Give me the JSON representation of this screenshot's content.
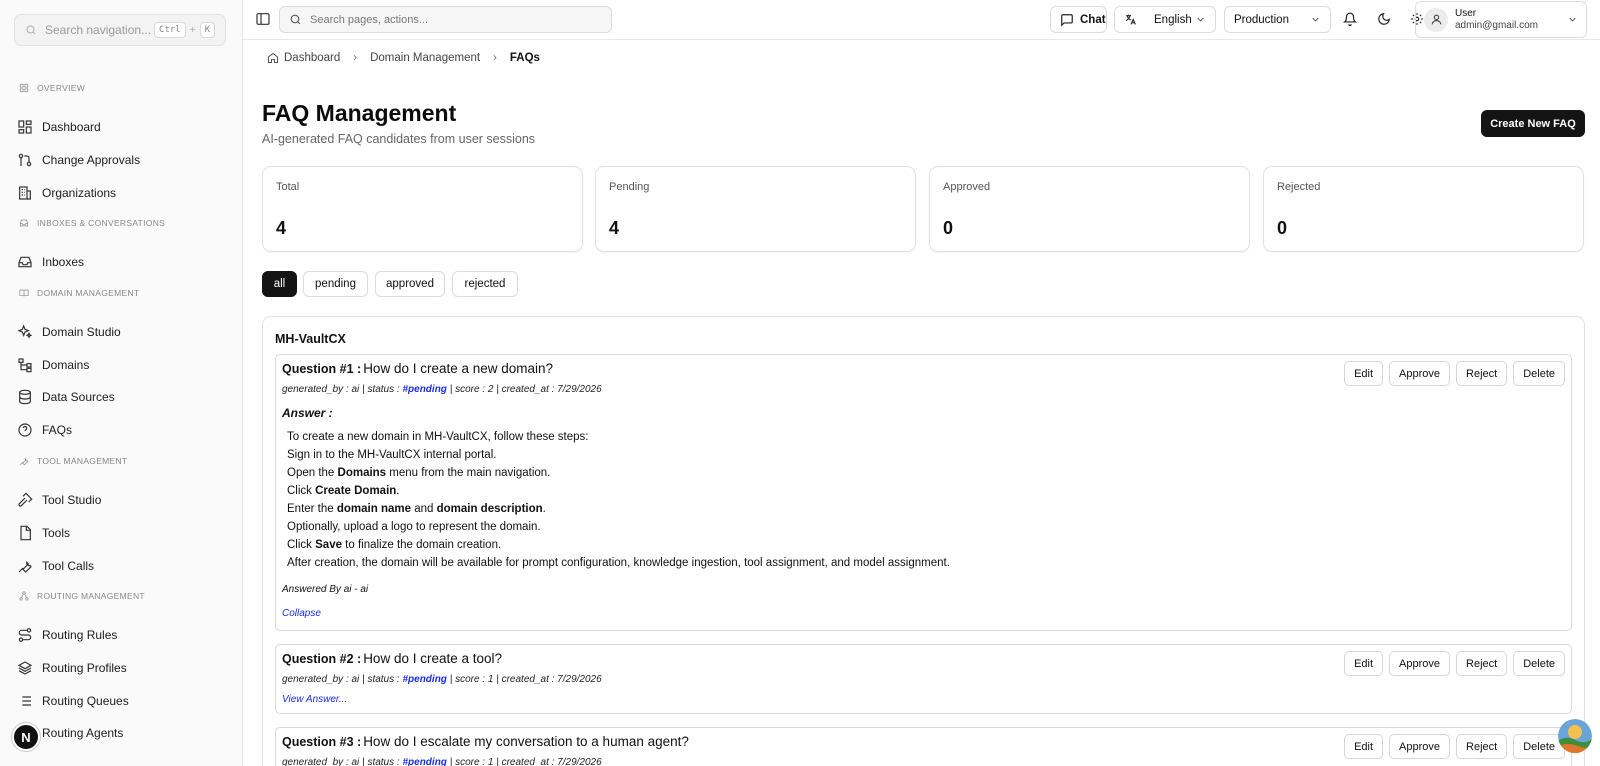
{
  "sidebar": {
    "search_placeholder": "Search navigation...",
    "kbd_1": "Ctrl",
    "kbd_sep": "+",
    "kbd_2": "K",
    "sections": {
      "overview": "OVERVIEW",
      "inboxes": "INBOXES & CONVERSATIONS",
      "domain": "DOMAIN MANAGEMENT",
      "tool": "TOOL MANAGEMENT",
      "routing": "ROUTING MANAGEMENT"
    },
    "items": {
      "dashboard": "Dashboard",
      "change_approvals": "Change Approvals",
      "organizations": "Organizations",
      "inboxes": "Inboxes",
      "domain_studio": "Domain Studio",
      "domains": "Domains",
      "data_sources": "Data Sources",
      "faqs": "FAQs",
      "tool_studio": "Tool Studio",
      "tools": "Tools",
      "tool_calls": "Tool Calls",
      "routing_rules": "Routing Rules",
      "routing_profiles": "Routing Profiles",
      "routing_queues": "Routing Queues",
      "routing_agents": "Routing Agents"
    },
    "badge": "N"
  },
  "topbar": {
    "search_placeholder": "Search pages, actions...",
    "chat": "Chat",
    "language": "English",
    "environment": "Production",
    "user_name": "User",
    "user_email": "admin@gmail.com"
  },
  "breadcrumb": {
    "home": "Dashboard",
    "parent": "Domain Management",
    "current": "FAQs"
  },
  "header": {
    "title": "FAQ Management",
    "subtitle": "AI-generated FAQ candidates from user sessions",
    "create_button": "Create New FAQ"
  },
  "stats": {
    "total_label": "Total",
    "total_value": "4",
    "pending_label": "Pending",
    "pending_value": "4",
    "approved_label": "Approved",
    "approved_value": "0",
    "rejected_label": "Rejected",
    "rejected_value": "0"
  },
  "filters": {
    "all": "all",
    "pending": "pending",
    "approved": "approved",
    "rejected": "rejected"
  },
  "group": {
    "title": "MH-VaultCX",
    "actions": {
      "edit": "Edit",
      "approve": "Approve",
      "reject": "Reject",
      "delete": "Delete"
    },
    "q1": {
      "num": "Question #1 :",
      "text": "How do I create a new domain?",
      "meta_gen": "generated_by : ai",
      "meta_status": "status :",
      "status": "#pending",
      "meta_score": "score : 2",
      "meta_created": "created_at : 7/29/2026",
      "answer_label": "Answer :",
      "l1": "To create a new domain in MH-VaultCX, follow these steps:",
      "l2": "Sign in to the MH-VaultCX internal portal.",
      "l3a": "Open the ",
      "l3b": "Domains",
      "l3c": " menu from the main navigation.",
      "l4a": "Click ",
      "l4b": "Create Domain",
      "l4c": ".",
      "l5a": "Enter the ",
      "l5b": "domain name",
      "l5c": " and ",
      "l5d": "domain description",
      "l5e": ".",
      "l6": "Optionally, upload a logo to represent the domain.",
      "l7a": "Click ",
      "l7b": "Save",
      "l7c": " to finalize the domain creation.",
      "l8": "After creation, the domain will be available for prompt configuration, knowledge ingestion, tool assignment, and model assignment.",
      "answered_by": "Answered By ai - ai",
      "collapse": "Collapse"
    },
    "q2": {
      "num": "Question #2 :",
      "text": "How do I create a tool?",
      "meta_gen": "generated_by : ai",
      "meta_status": "status :",
      "status": "#pending",
      "meta_score": "score : 1",
      "meta_created": "created_at : 7/29/2026",
      "view": "View Answer..."
    },
    "q3": {
      "num": "Question #3 :",
      "text": "How do I escalate my conversation to a human agent?",
      "meta_gen": "generated_by : ai",
      "meta_status": "status :",
      "status": "#pending",
      "meta_score": "score : 1",
      "meta_created": "created_at : 7/29/2026"
    }
  }
}
